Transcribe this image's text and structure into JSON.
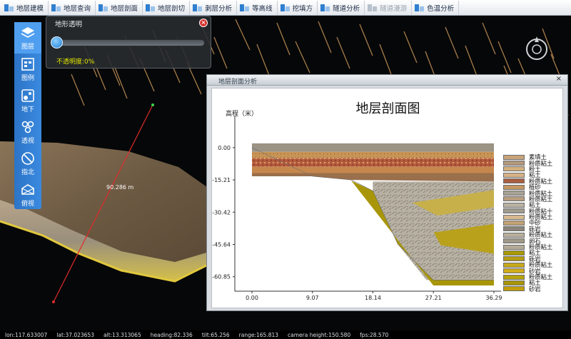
{
  "toolbar": {
    "items": [
      {
        "label": "地层建模",
        "disabled": false
      },
      {
        "label": "地层查询",
        "disabled": false
      },
      {
        "label": "地层剖面",
        "disabled": false
      },
      {
        "label": "地层剖切",
        "disabled": false
      },
      {
        "label": "剥层分析",
        "disabled": false
      },
      {
        "label": "等高线",
        "disabled": false
      },
      {
        "label": "挖填方",
        "disabled": false
      },
      {
        "label": "隧道分析",
        "disabled": false
      },
      {
        "label": "隧道漫游",
        "disabled": true
      },
      {
        "label": "色温分析",
        "disabled": false
      }
    ]
  },
  "sidebar": {
    "items": [
      {
        "label": "图层",
        "icon": "layers-icon",
        "active": true
      },
      {
        "label": "图例",
        "icon": "legend-icon",
        "active": false
      },
      {
        "label": "地下",
        "icon": "underground-icon",
        "active": false
      },
      {
        "label": "透视",
        "icon": "perspective-icon",
        "active": false
      },
      {
        "label": "指北",
        "icon": "compass-icon",
        "active": false
      },
      {
        "label": "俯视",
        "icon": "topview-icon",
        "active": false
      }
    ]
  },
  "opacity_panel": {
    "title": "地形透明",
    "label": "不透明度:0%",
    "opacity_percent": 0
  },
  "measure": {
    "distance_label": "90.286 m"
  },
  "section_window": {
    "title": "地层剖面分析",
    "close_glyph": "×"
  },
  "chart_data": {
    "type": "area",
    "title": "地层剖面图",
    "ylabel": "高程（米）",
    "xlabel": "",
    "x_ticks": [
      "0.00",
      "9.07",
      "18.14",
      "27.21",
      "36.29"
    ],
    "y_ticks": [
      "0.00",
      "-15.21",
      "-30.42",
      "-45.64",
      "-60.85"
    ],
    "xlim": [
      0,
      36.29
    ],
    "ylim": [
      -67,
      5
    ],
    "ground_profile": {
      "x": [
        0,
        9.07,
        14.9,
        18.14,
        21.9,
        27.21,
        36.29
      ],
      "y": [
        0,
        -13.5,
        -15.21,
        -20.4,
        -45.6,
        -62.4,
        -62.4
      ]
    },
    "legend": [
      {
        "label": "素填土",
        "color": "#c8a47a"
      },
      {
        "label": "粉质粘土",
        "color": "#b4997c"
      },
      {
        "label": "粉土",
        "color": "#d3b07d"
      },
      {
        "label": "粘土",
        "color": "#d7b286"
      },
      {
        "label": "粉质粘土",
        "color": "#a95e40"
      },
      {
        "label": "植砂",
        "color": "#c39762"
      },
      {
        "label": "粉质粘土",
        "color": "#a8a294"
      },
      {
        "label": "粉质粘土",
        "color": "#b89e80"
      },
      {
        "label": "粘土",
        "color": "#b9b2a2"
      },
      {
        "label": "粉质粘十",
        "color": "#9f9b8f"
      },
      {
        "label": "粉质粘土",
        "color": "#d6b98e"
      },
      {
        "label": "中砂",
        "color": "#c2a275"
      },
      {
        "label": "砾岩",
        "color": "#8a857a"
      },
      {
        "label": "粉质粘土",
        "color": "#b8b09c"
      },
      {
        "label": "卵石",
        "color": "#a09988"
      },
      {
        "label": "粉质粘土",
        "color": "#b3aa96"
      },
      {
        "label": "粘土",
        "color": "#aa9a05"
      },
      {
        "label": "砾岩",
        "color": "#b49b12"
      },
      {
        "label": "粉质粘土",
        "color": "#c7a91a"
      },
      {
        "label": "砂岩",
        "color": "#d0ad1a"
      },
      {
        "label": "粉质粘土",
        "color": "#b8a30d"
      },
      {
        "label": "粘土",
        "color": "#a89608"
      },
      {
        "label": "砂岩",
        "color": "#c29e08"
      }
    ]
  },
  "statusbar": {
    "lon": "lon:117.633007",
    "lat": "lat:37.023653",
    "alt": "alt:13.313065",
    "heading": "heading:82.336",
    "tilt": "tilt:65.256",
    "range": "range:165.813",
    "camera_height": "camera height:150.580",
    "fps": "fps:28.570"
  }
}
